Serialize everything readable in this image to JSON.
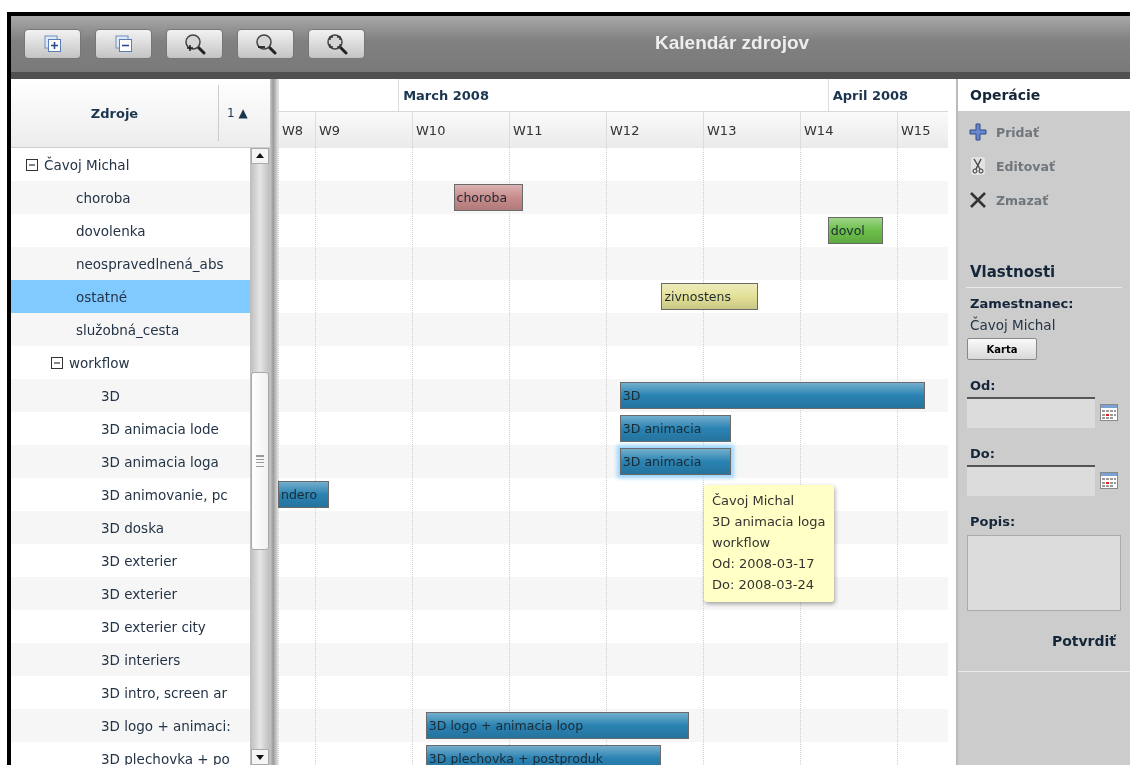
{
  "toolbar": {
    "buttons": [
      {
        "kind": "expand-all"
      },
      {
        "kind": "collapse-all"
      },
      {
        "kind": "zoom-in"
      },
      {
        "kind": "zoom-out"
      },
      {
        "kind": "zoom-fit"
      }
    ],
    "title": "Kalendár zdrojov"
  },
  "resource_list": {
    "columns": [
      "Zdroje",
      "1 ▲"
    ]
  },
  "resources": [
    {
      "name": "Čavoj Michal",
      "expanded": true,
      "selected": false,
      "children": [
        {
          "name": "choroba",
          "selected": false,
          "tasks": [
            {
              "label": "choroba",
              "color": "#c98b8b",
              "selected": false
            }
          ]
        },
        {
          "name": "dovolenka",
          "selected": false,
          "tasks": [
            {
              "label": "dovol",
              "color": "#6cbf4a",
              "selected": false
            }
          ]
        },
        {
          "name": "neospravedlnená_abs",
          "selected": false
        },
        {
          "name": "ostatné",
          "selected": true,
          "tasks": [
            {
              "label": "zivnostens",
              "color": "#e3e196",
              "selected": false
            }
          ]
        },
        {
          "name": "služobná_cesta",
          "selected": false
        },
        {
          "name": "workflow",
          "expanded": true,
          "selected": false,
          "children": [
            {
              "name": "3D",
              "selected": false,
              "tasks": [
                {
                  "label": "3D",
                  "color": "#2a83b3",
                  "selected": false
                }
              ]
            },
            {
              "name": "3D animacia lode",
              "selected": false,
              "tasks": [
                {
                  "label": "3D animacia",
                  "color": "#2a83b3",
                  "selected": false
                }
              ]
            },
            {
              "name": "3D animacia loga",
              "selected": false,
              "tasks": [
                {
                  "label": "3D animacia",
                  "color": "#2a83b3",
                  "selected": true
                }
              ]
            },
            {
              "name": "3D animovanie, pc",
              "selected": false,
              "tasks": [
                {
                  "label": "ndero",
                  "color": "#2a83b3",
                  "selected": false
                }
              ]
            },
            {
              "name": "3D doska",
              "selected": false
            },
            {
              "name": "3D exterier",
              "selected": false
            },
            {
              "name": "3D exterier",
              "selected": false
            },
            {
              "name": "3D exterier city",
              "selected": false
            },
            {
              "name": "3D interiers",
              "selected": false
            },
            {
              "name": "3D intro, screen ar",
              "selected": false
            },
            {
              "name": "3D logo + animaci:",
              "selected": false,
              "tasks": [
                {
                  "label": "3D logo + animacia loop",
                  "color": "#2a83b3",
                  "selected": false
                }
              ]
            },
            {
              "name": "3D plechovka + po",
              "selected": false,
              "tasks": [
                {
                  "label": "3D plechovka + postproduk",
                  "color": "#2a83b3",
                  "selected": false
                }
              ]
            }
          ]
        }
      ]
    }
  ],
  "timeline": {
    "months": [
      "March 2008",
      "April 2008"
    ],
    "weeks": [
      "W8",
      "W9",
      "W10",
      "W11",
      "W12",
      "W13",
      "W14",
      "W15"
    ]
  },
  "tooltip": {
    "lines": [
      "Čavoj Michal",
      "3D animacia loga",
      "workflow",
      "Od: 2008-03-17",
      "Do: 2008-03-24"
    ]
  },
  "operations": {
    "title": "Operácie",
    "items": [
      {
        "kind": "add",
        "label": "Pridať",
        "disabled": true
      },
      {
        "kind": "edit",
        "label": "Editovať",
        "disabled": true
      },
      {
        "kind": "delete",
        "label": "Zmazať",
        "disabled": true
      }
    ]
  },
  "properties": {
    "title": "Vlastnosti",
    "employee_label": "Zamestnanec:",
    "employee_value": "Čavoj Michal",
    "card_button": "Karta",
    "fields": [
      {
        "kind": "date",
        "label": "Od:"
      },
      {
        "kind": "date",
        "label": "Do:"
      },
      {
        "kind": "textarea",
        "label": "Popis:"
      }
    ],
    "confirm_button": "Potvrdiť"
  }
}
